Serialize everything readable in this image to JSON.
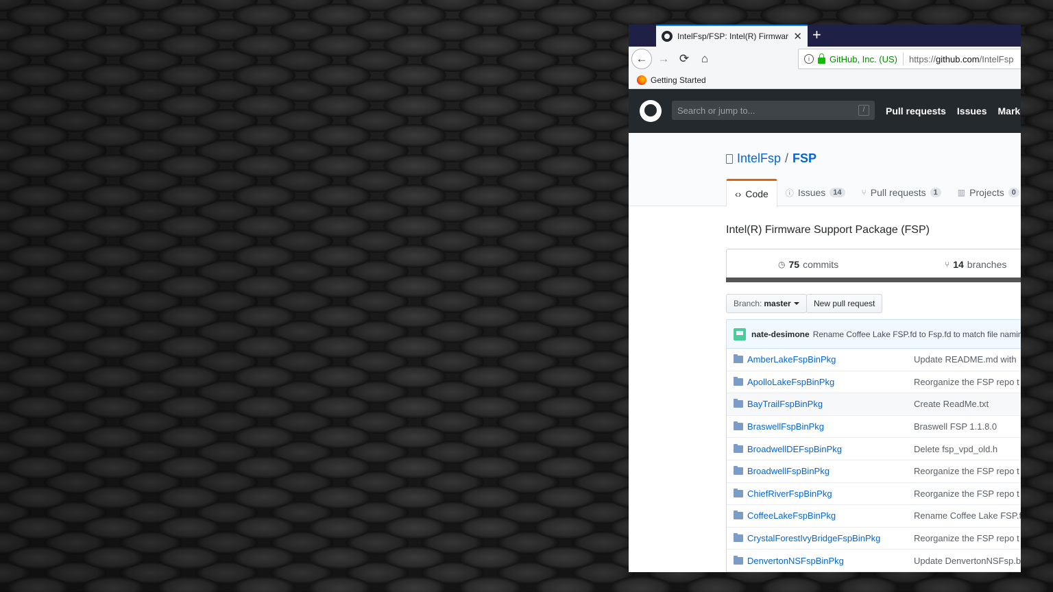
{
  "browser": {
    "tab_title": "IntelFsp/FSP: Intel(R) Firmware Support Package",
    "url_org": "GitHub, Inc. (US)",
    "url_prefix": "https://",
    "url_domain": "github.com",
    "url_path": "/IntelFsp",
    "bookmark": "Getting Started"
  },
  "github": {
    "search_placeholder": "Search or jump to...",
    "search_shortcut": "/",
    "nav": [
      "Pull requests",
      "Issues",
      "Marketplace"
    ]
  },
  "repo": {
    "owner": "IntelFsp",
    "separator": "/",
    "name": "FSP",
    "tabs": [
      {
        "label": "Code",
        "count": ""
      },
      {
        "label": "Issues",
        "count": "14"
      },
      {
        "label": "Pull requests",
        "count": "1"
      },
      {
        "label": "Projects",
        "count": "0"
      }
    ],
    "description": "Intel(R) Firmware Support Package (FSP)",
    "commits_count": "75",
    "commits_label": "commits",
    "branches_count": "14",
    "branches_label": "branches",
    "branch_prefix": "Branch:",
    "branch_name": "master",
    "new_pr_label": "New pull request",
    "latest_commit_author": "nate-desimone",
    "latest_commit_message": "Rename Coffee Lake FSP.fd to Fsp.fd to match file naming in",
    "files": [
      {
        "name": "AmberLakeFspBinPkg",
        "message": "Update README.md with"
      },
      {
        "name": "ApolloLakeFspBinPkg",
        "message": "Reorganize the FSP repo t"
      },
      {
        "name": "BayTrailFspBinPkg",
        "message": "Create ReadMe.txt"
      },
      {
        "name": "BraswellFspBinPkg",
        "message": "Braswell FSP 1.1.8.0"
      },
      {
        "name": "BroadwellDEFspBinPkg",
        "message": "Delete fsp_vpd_old.h"
      },
      {
        "name": "BroadwellFspBinPkg",
        "message": "Reorganize the FSP repo t"
      },
      {
        "name": "ChiefRiverFspBinPkg",
        "message": "Reorganize the FSP repo t"
      },
      {
        "name": "CoffeeLakeFspBinPkg",
        "message": "Rename Coffee Lake FSP.fd"
      },
      {
        "name": "CrystalForestIvyBridgeFspBinPkg",
        "message": "Reorganize the FSP repo t"
      },
      {
        "name": "DenvertonNSFspBinPkg",
        "message": "Update DenvertonNSFsp.b"
      }
    ]
  }
}
